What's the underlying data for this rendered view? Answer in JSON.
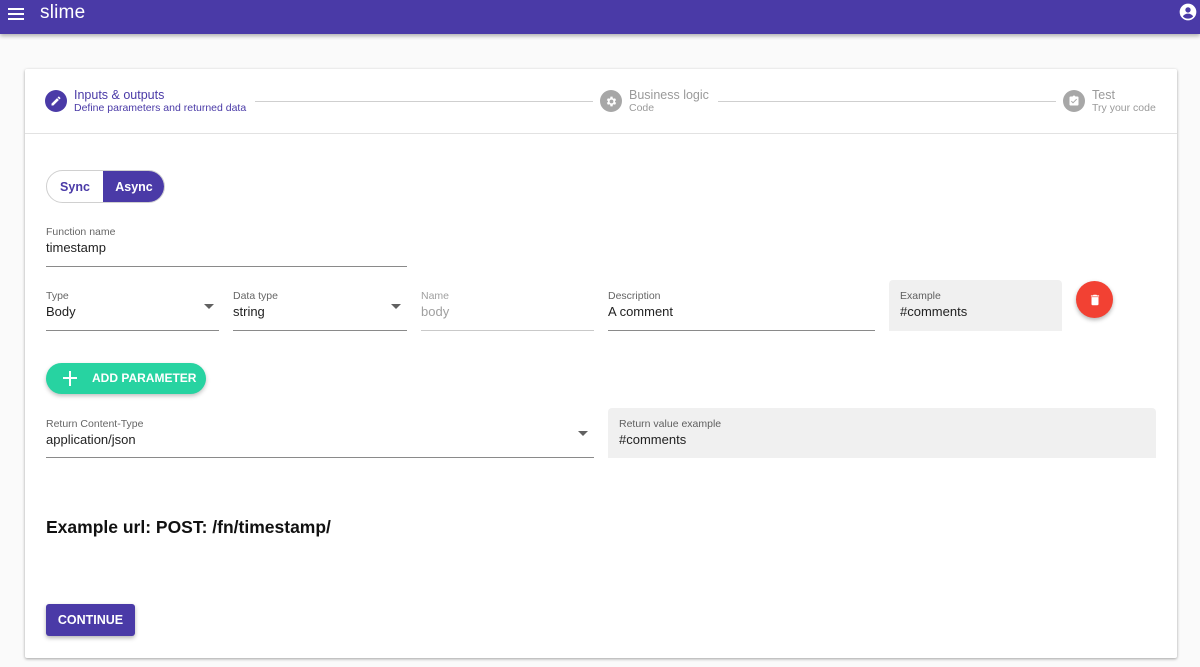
{
  "app": {
    "title": "slime"
  },
  "icons": {
    "menu": "menu-icon",
    "account": "account-circle-icon",
    "edit": "pencil-icon",
    "settings": "gear-icon",
    "test": "clipboard-check-icon",
    "delete": "trash-icon",
    "add": "plus-icon",
    "dropdown": "caret-down-icon"
  },
  "colors": {
    "primary": "#4a3aa7",
    "accent": "#27d3a1",
    "danger": "#f24133",
    "inactive": "#a7a7a7"
  },
  "stepper": [
    {
      "title": "Inputs & outputs",
      "subtitle": "Define parameters and returned data",
      "state": "active"
    },
    {
      "title": "Business logic",
      "subtitle": "Code",
      "state": "inactive"
    },
    {
      "title": "Test",
      "subtitle": "Try your code",
      "state": "inactive"
    }
  ],
  "mode_toggle": {
    "sync_label": "Sync",
    "async_label": "Async",
    "selected": "Async"
  },
  "function_name": {
    "label": "Function name",
    "value": "timestamp"
  },
  "parameter": {
    "type": {
      "label": "Type",
      "value": "Body"
    },
    "data_type": {
      "label": "Data type",
      "value": "string"
    },
    "name": {
      "label": "Name",
      "value": "body"
    },
    "description": {
      "label": "Description",
      "value": "A comment"
    },
    "example": {
      "label": "Example",
      "value": "#comments"
    }
  },
  "add_parameter": {
    "label": "ADD PARAMETER"
  },
  "return_content_type": {
    "label": "Return Content-Type",
    "value": "application/json"
  },
  "return_value_example": {
    "label": "Return value example",
    "value": "#comments"
  },
  "example_url": "Example url: POST: /fn/timestamp/",
  "continue_button": {
    "label": "CONTINUE"
  }
}
